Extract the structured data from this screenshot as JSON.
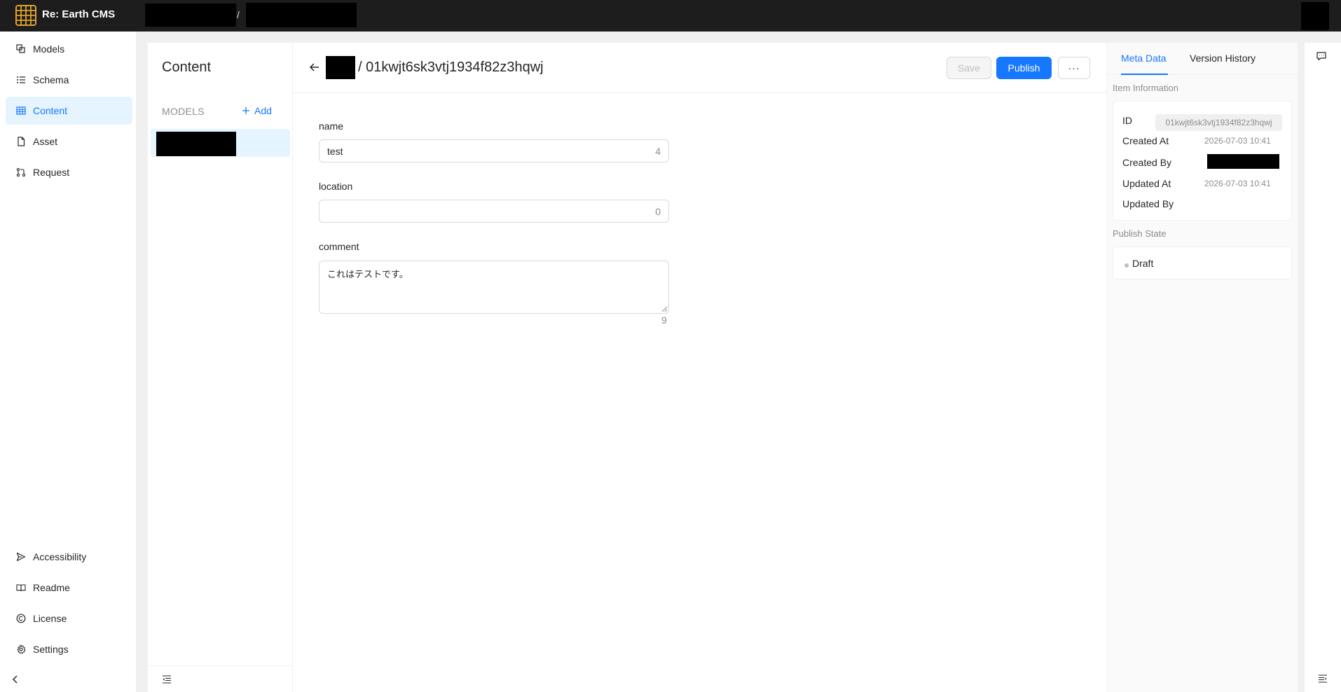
{
  "header": {
    "brand": "Re: Earth CMS",
    "breadcrumb_sep": "/"
  },
  "nav": {
    "items": [
      {
        "label": "Models",
        "icon": "models-icon"
      },
      {
        "label": "Schema",
        "icon": "schema-icon"
      },
      {
        "label": "Content",
        "icon": "table-icon",
        "active": true
      },
      {
        "label": "Asset",
        "icon": "file-icon"
      },
      {
        "label": "Request",
        "icon": "pull-request-icon"
      }
    ],
    "bottom_items": [
      {
        "label": "Accessibility",
        "icon": "send-icon"
      },
      {
        "label": "Readme",
        "icon": "book-icon"
      },
      {
        "label": "License",
        "icon": "copyright-icon"
      },
      {
        "label": "Settings",
        "icon": "gear-icon"
      }
    ]
  },
  "models_panel": {
    "title": "Content",
    "section_label": "MODELS",
    "add_label": "Add"
  },
  "item": {
    "title_suffix": "/ 01kwjt6sk3vtj1934f82z3hqwj",
    "save_label": "Save",
    "publish_label": "Publish",
    "more_label": "···",
    "fields": {
      "name": {
        "label": "name",
        "value": "test",
        "count": "4"
      },
      "location": {
        "label": "location",
        "value": "",
        "count": "0"
      },
      "comment": {
        "label": "comment",
        "value": "これはテストです。",
        "count": "9"
      }
    }
  },
  "meta": {
    "tab_meta": "Meta Data",
    "tab_history": "Version History",
    "item_info_label": "Item Information",
    "id_label": "ID",
    "id_value": "01kwjt6sk3vtj1934f82z3hqwj",
    "created_at_label": "Created At",
    "created_at_value": "2026-07-03 10:41",
    "created_by_label": "Created By",
    "updated_at_label": "Updated At",
    "updated_at_value": "2026-07-03 10:41",
    "updated_by_label": "Updated By",
    "publish_state_label": "Publish State",
    "publish_state_value": "Draft"
  },
  "colors": {
    "accent": "#1677ff",
    "topbar": "#1d1d1d",
    "active_bg": "#e6f4ff"
  }
}
